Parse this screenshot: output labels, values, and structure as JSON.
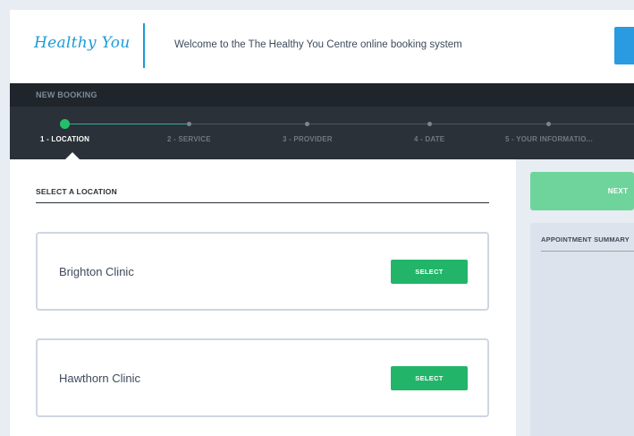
{
  "header": {
    "logo_text": "Healthy You",
    "welcome_text": "Welcome to the The Healthy You Centre online booking system"
  },
  "booking": {
    "title": "NEW BOOKING",
    "steps": [
      {
        "label": "1 - LOCATION",
        "active": true
      },
      {
        "label": "2 - SERVICE",
        "active": false
      },
      {
        "label": "3 - PROVIDER",
        "active": false
      },
      {
        "label": "4 - DATE",
        "active": false
      },
      {
        "label": "5 - YOUR INFORMATIO...",
        "active": false
      }
    ]
  },
  "main": {
    "section_title": "SELECT A LOCATION",
    "locations": [
      {
        "name": "Brighton Clinic",
        "button": "SELECT"
      },
      {
        "name": "Hawthorn Clinic",
        "button": "SELECT"
      }
    ]
  },
  "sidebar": {
    "next_label": "NEXT",
    "summary_title": "APPOINTMENT SUMMARY"
  },
  "colors": {
    "brand": "#1a9bd7",
    "accent_green": "#22b56a",
    "dark_band": "#2b3138"
  }
}
